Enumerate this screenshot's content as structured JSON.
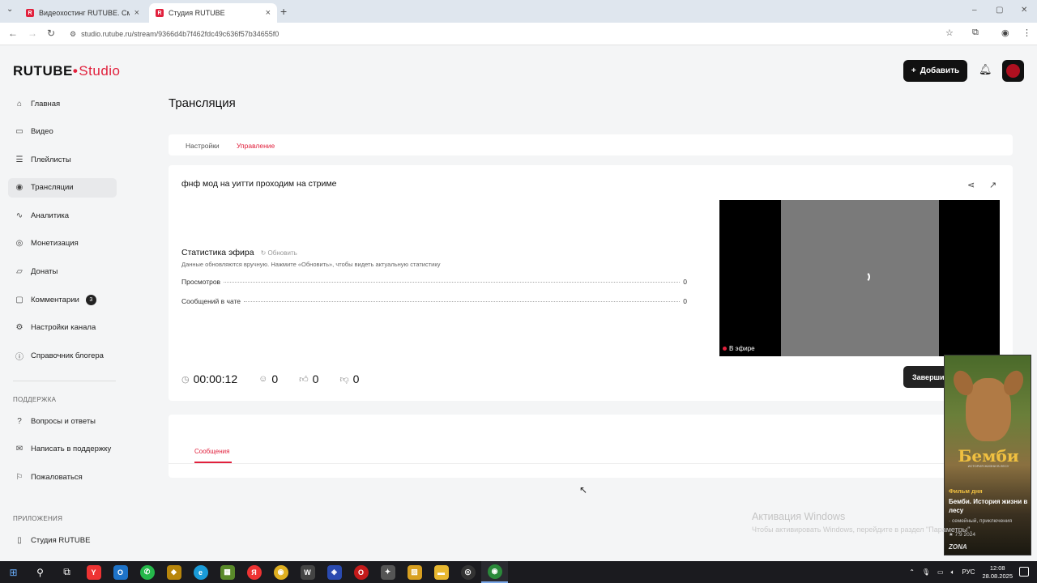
{
  "browser": {
    "tabs": [
      {
        "title": "Видеохостинг RUTUBE. Смотр",
        "favicon": "R"
      },
      {
        "title": "Студия RUTUBE",
        "favicon": "R"
      }
    ],
    "url": "studio.rutube.ru/stream/9366d4b7f462fdc49c636f57b34655f0"
  },
  "logo": {
    "main": "RUTUBE",
    "suffix": "Studio"
  },
  "sidebar": {
    "items": [
      {
        "label": "Главная",
        "icon": "home-icon"
      },
      {
        "label": "Видео",
        "icon": "video-icon"
      },
      {
        "label": "Плейлисты",
        "icon": "playlist-icon"
      },
      {
        "label": "Трансляции",
        "icon": "broadcast-icon",
        "active": true
      },
      {
        "label": "Аналитика",
        "icon": "analytics-icon"
      },
      {
        "label": "Монетизация",
        "icon": "monetization-icon"
      },
      {
        "label": "Донаты",
        "icon": "donate-icon"
      },
      {
        "label": "Комментарии",
        "icon": "comment-icon",
        "badge": "3"
      },
      {
        "label": "Настройки канала",
        "icon": "gear-icon"
      },
      {
        "label": "Справочник блогера",
        "icon": "info-icon"
      }
    ],
    "support_heading": "ПОДДЕРЖКА",
    "support_items": [
      {
        "label": "Вопросы и ответы",
        "icon": "question-icon"
      },
      {
        "label": "Написать в поддержку",
        "icon": "mail-icon"
      },
      {
        "label": "Пожаловаться",
        "icon": "flag-icon"
      }
    ],
    "apps_heading": "ПРИЛОЖЕНИЯ",
    "apps_items": [
      {
        "label": "Студия RUTUBE",
        "icon": "phone-icon"
      }
    ]
  },
  "header": {
    "add_label": "Добавить"
  },
  "page": {
    "title": "Трансляция",
    "tabs": [
      "Настройки",
      "Управление"
    ],
    "selected_tab": "Управление"
  },
  "stream": {
    "title": "фнф мод на уитти проходим на стриме",
    "stats_title": "Статистика эфира",
    "refresh_label": "Обновить",
    "stats_note": "Данные обновляются вручную. Нажмите «Обновить», чтобы видеть актуальную статистику",
    "stats": [
      {
        "label": "Просмотров",
        "value": "0"
      },
      {
        "label": "Сообщений в чате",
        "value": "0"
      }
    ],
    "duration": "00:00:12",
    "viewers": "0",
    "likes": "0",
    "dislikes": "0",
    "live_label": "В эфире",
    "end_label": "Завершить"
  },
  "messages": {
    "tab_label": "Сообщения"
  },
  "ad": {
    "poster_title": "Бемби",
    "poster_sub": "ИСТОРИЯ ЖИЗНИ В ЛЕСУ",
    "label": "Фильм дня",
    "name": "Бемби. История жизни в лесу",
    "genre": "· семейный, приключения",
    "rating": "★ 7.9 2024",
    "brand": "ZONA"
  },
  "watermark": {
    "title": "Активация Windows",
    "subtitle": "Чтобы активировать Windows, перейдите в раздел \"Параметры\"."
  },
  "taskbar": {
    "lang": "РУС",
    "time": "12:08",
    "date": "28.08.2025"
  },
  "colors": {
    "accent": "#e1213d",
    "dark": "#111111"
  }
}
